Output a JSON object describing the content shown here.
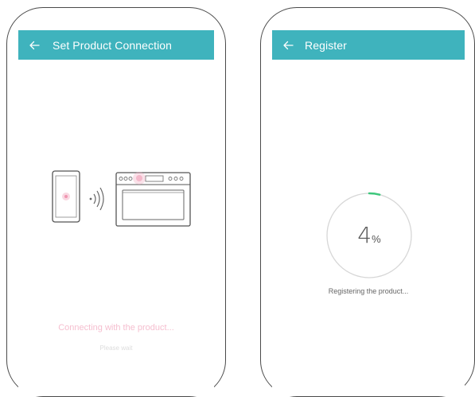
{
  "screens": {
    "connection": {
      "title": "Set Product Connection",
      "status": "Connecting with the product...",
      "substatus": "Please wait"
    },
    "register": {
      "title": "Register",
      "progress_percent": 4,
      "progress_number": "4",
      "progress_unit": "%",
      "status": "Registering the product..."
    }
  },
  "colors": {
    "appbar": "#3fb3bd",
    "accent_pink": "#f2a9bf",
    "progress_arc": "#3ec77c",
    "progress_track": "#d7d7d7"
  },
  "icons": {
    "back": "arrow-left-icon",
    "phone": "smartphone-icon",
    "signal": "wireless-signal-icon",
    "appliance": "oven-icon"
  }
}
